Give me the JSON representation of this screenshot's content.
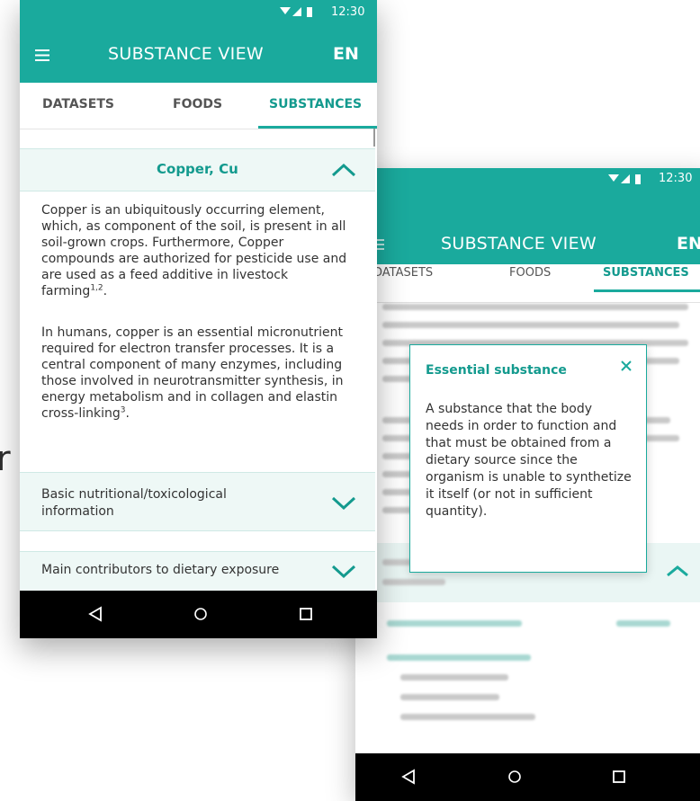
{
  "front": {
    "status": {
      "time": "12:30"
    },
    "appbar": {
      "title": "SUBSTANCE VIEW",
      "lang": "EN"
    },
    "tabs": [
      "DATASETS",
      "FOODS",
      "SUBSTANCES"
    ],
    "substance": {
      "title": "Copper, Cu",
      "paragraph1": "Copper is an ubiquitously occurring element, which, as component of the soil, is present in all soil-grown crops. Furthermore, Copper compounds are authorized for pesticide use and are used as a feed additive in livestock farming",
      "paragraph1_ref": "1,2",
      "paragraph2": "In humans, copper is an essential micronutrient required for electron transfer processes. It is a central component of many enzymes, including those involved in neurotransmitter synthesis, in energy metabolism and in collagen and elastin cross-linking",
      "paragraph2_ref": "3"
    },
    "sections": [
      {
        "label": "Basic nutritional/toxicological information"
      },
      {
        "label": "Main contributors to dietary exposure"
      }
    ]
  },
  "back": {
    "status": {
      "time": "12:30"
    },
    "appbar": {
      "title": "SUBSTANCE VIEW",
      "lang": "EN"
    },
    "tabs": [
      "DATASETS",
      "FOODS",
      "SUBSTANCES"
    ],
    "popup": {
      "title": "Essential substance",
      "body": "A substance that the body needs in order to function and that must be obtained from a dietary source since the organism is unable to synthetize it itself (or not in sufficient quantity)."
    }
  },
  "stray_text": "r",
  "colors": {
    "teal": "#1aaa9d",
    "teal_dark": "#139a8e",
    "accordion_bg": "#eef8f6"
  },
  "icons": [
    "menu-icon",
    "wifi-icon",
    "signal-icon",
    "battery-icon",
    "chevron-up-icon",
    "chevron-down-icon",
    "close-icon",
    "back-nav-icon",
    "home-nav-icon",
    "recents-nav-icon"
  ]
}
